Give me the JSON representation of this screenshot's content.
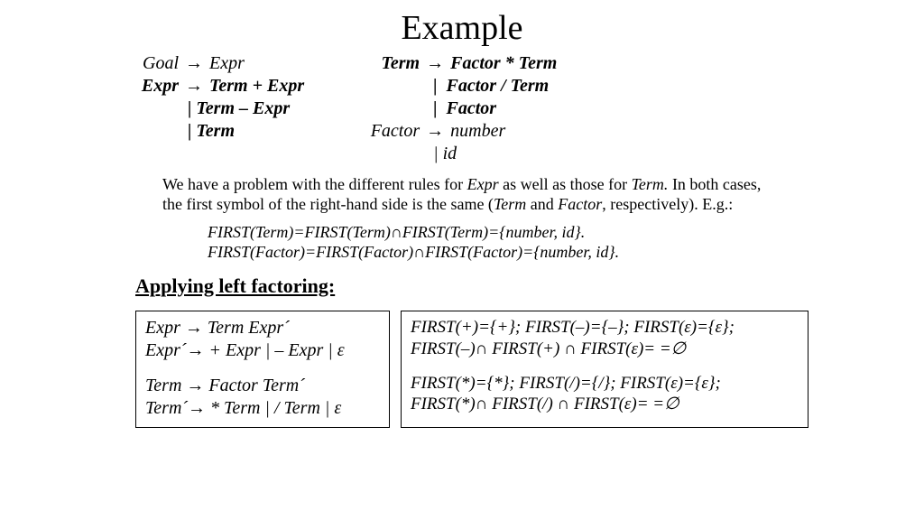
{
  "title": "Example",
  "grammar": {
    "left": {
      "l1_lhs": "Goal",
      "l1_rhs": "Expr",
      "l2_lhs": "Expr",
      "l2_rhs": "Term + Expr",
      "l3_rhs": "Term – Expr",
      "l4_rhs": "Term"
    },
    "right": {
      "r1_lhs": "Term",
      "r1_rhs": "Factor * Term",
      "r2_rhs": "Factor / Term",
      "r3_rhs": "Factor",
      "r4_lhs": "Factor",
      "r4_rhs": "number",
      "r5_rhs": "id"
    }
  },
  "arrow": "→",
  "pipe": "|",
  "explanation": {
    "p1a": "We have a problem with the different rules for ",
    "p1b": "Expr",
    "p1c": " as well as those for ",
    "p1d": "Term.",
    "p1e": " In both cases, the first symbol of the right-hand side is the same (",
    "p1f": "Term",
    "p1g": " and ",
    "p1h": "Factor",
    "p1i": ", respectively). E.g.:"
  },
  "first_lines": {
    "l1": "FIRST(Term)=FIRST(Term)∩FIRST(Term)={number, id}.",
    "l2": "FIRST(Factor)=FIRST(Factor)∩FIRST(Factor)={number, id}."
  },
  "applying": "Applying left factoring:",
  "box1": {
    "b1": "Expr → Term Expr´",
    "b2": "Expr´→ + Expr | – Expr | ε",
    "b3": "Term → Factor Term´",
    "b4": "Term´→ * Term | / Term | ε"
  },
  "box2": {
    "c1": "FIRST(+)={+}; FIRST(–)={–}; FIRST(ε)={ε};",
    "c2": "FIRST(–)∩ FIRST(+) ∩ FIRST(ε)= =∅",
    "c3": "FIRST(*)={*}; FIRST(/)={/}; FIRST(ε)={ε};",
    "c4": "FIRST(*)∩ FIRST(/) ∩ FIRST(ε)= =∅"
  }
}
